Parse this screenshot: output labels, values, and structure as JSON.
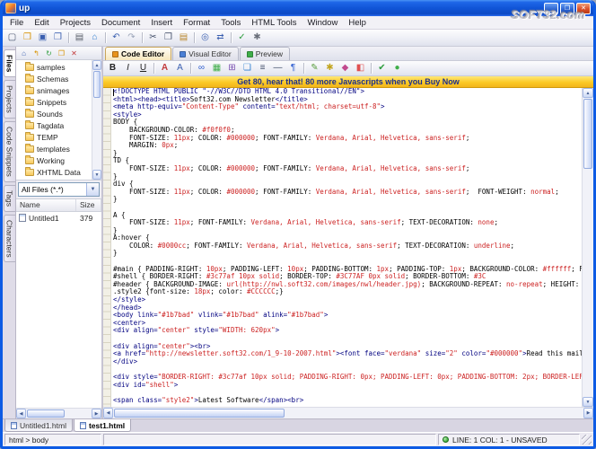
{
  "window": {
    "title": "up"
  },
  "watermark": "SOFT32.com",
  "icons": {
    "minimize": "_",
    "maximize": "❐",
    "close": "✕",
    "up": "▲",
    "down": "▼",
    "left": "◀",
    "right": "▶"
  },
  "menu": {
    "items": [
      "File",
      "Edit",
      "Projects",
      "Document",
      "Insert",
      "Format",
      "Tools",
      "HTML Tools",
      "Window",
      "Help"
    ]
  },
  "toolbar_main": {
    "icons": [
      {
        "n": "new-document",
        "g": "▢",
        "c": "#44506a"
      },
      {
        "n": "open-folder",
        "g": "❒",
        "c": "#d79200"
      },
      {
        "n": "save",
        "g": "▣",
        "c": "#3a5fb0"
      },
      {
        "n": "save-all",
        "g": "❐",
        "c": "#3a5fb0"
      },
      "|",
      {
        "n": "print",
        "g": "▤",
        "c": "#5a5f6a"
      },
      {
        "n": "preview-in-browser",
        "g": "⌂",
        "c": "#2f7fd0"
      },
      "|",
      {
        "n": "undo",
        "g": "↶",
        "c": "#3a5fb0"
      },
      {
        "n": "redo",
        "g": "↷",
        "c": "#9aa4b8"
      },
      "|",
      {
        "n": "cut",
        "g": "✂",
        "c": "#44506a"
      },
      {
        "n": "copy",
        "g": "❐",
        "c": "#44506a"
      },
      {
        "n": "paste",
        "g": "▤",
        "c": "#b8862a"
      },
      "|",
      {
        "n": "find",
        "g": "◎",
        "c": "#3a5fb0"
      },
      {
        "n": "find-replace",
        "g": "⇄",
        "c": "#3a5fb0"
      },
      "|",
      {
        "n": "spell-check",
        "g": "✓",
        "c": "#2f9e3f"
      },
      {
        "n": "settings",
        "g": "✱",
        "c": "#6a6f7a"
      }
    ]
  },
  "view_tabs": {
    "tabs": [
      {
        "label": "Code Editor",
        "active": true,
        "icon_color": "#e8931c"
      },
      {
        "label": "Visual Editor",
        "active": false,
        "icon_color": "#4a7fd6"
      },
      {
        "label": "Preview",
        "active": false,
        "icon_color": "#3fae49"
      }
    ]
  },
  "toolbar_html": {
    "icons": [
      {
        "n": "bold",
        "g": "B",
        "c": "#222222",
        "s": "b"
      },
      {
        "n": "italic",
        "g": "I",
        "c": "#222222",
        "s": "i"
      },
      {
        "n": "underline",
        "g": "U",
        "c": "#222222",
        "s": "u"
      },
      "|",
      {
        "n": "font-color",
        "g": "A",
        "c": "#c23a3a",
        "s": "b"
      },
      {
        "n": "font",
        "g": "A",
        "c": "#3a5fb0"
      },
      "|",
      {
        "n": "insert-link",
        "g": "∞",
        "c": "#2f5fd0"
      },
      {
        "n": "insert-image",
        "g": "▦",
        "c": "#3fae49"
      },
      {
        "n": "insert-table",
        "g": "⊞",
        "c": "#7a4fb0"
      },
      {
        "n": "insert-div",
        "g": "❏",
        "c": "#2f7fd0"
      },
      {
        "n": "insert-list",
        "g": "≡",
        "c": "#44506a"
      },
      {
        "n": "horizontal-rule",
        "g": "—",
        "c": "#44506a"
      },
      {
        "n": "line-break",
        "g": "¶",
        "c": "#2f5fd0"
      },
      "|",
      {
        "n": "insert-comment",
        "g": "✎",
        "c": "#5a9e3f"
      },
      {
        "n": "insert-script",
        "g": "✱",
        "c": "#c2a51e"
      },
      {
        "n": "insert-style",
        "g": "◆",
        "c": "#c24a8e"
      },
      {
        "n": "color-picker",
        "g": "◧",
        "c": "#e05050"
      },
      "|",
      {
        "n": "validate",
        "g": "✔",
        "c": "#2f9e3f"
      },
      {
        "n": "quick-preview",
        "g": "●",
        "c": "#3fae49"
      }
    ]
  },
  "banner": {
    "text": "Get 80, hear that! 80 more Javascripts when you Buy Now"
  },
  "side_tabs": {
    "items": [
      {
        "label": "Files",
        "active": true
      },
      {
        "label": "Projects",
        "active": false
      },
      {
        "label": "Code Snippets",
        "active": false
      },
      {
        "label": "Tags",
        "active": false
      },
      {
        "label": "Characters",
        "active": false
      }
    ]
  },
  "files_panel": {
    "toolbar": [
      {
        "n": "home-directory",
        "g": "⌂",
        "c": "#3a5fb0"
      },
      {
        "n": "up-one-level",
        "g": "↰",
        "c": "#d79200"
      },
      {
        "n": "refresh",
        "g": "↻",
        "c": "#2f9e3f"
      },
      {
        "n": "new-folder",
        "g": "❒",
        "c": "#d79200"
      },
      {
        "n": "delete",
        "g": "✕",
        "c": "#c23a3a"
      }
    ],
    "tree": [
      "samples",
      "Schemas",
      "snimages",
      "Snippets",
      "Sounds",
      "Tagdata",
      "TEMP",
      "templates",
      "Working",
      "XHTML Data"
    ],
    "filter": "All Files (*.*)",
    "list": {
      "columns": [
        "Name",
        "Size"
      ],
      "rows": [
        {
          "name": "Untitled1",
          "size": "379"
        }
      ]
    }
  },
  "editor": {
    "colors": {
      "tag": "#000080",
      "value": "#cc2222",
      "plain": "#000000"
    },
    "lines": [
      [
        [
          "t",
          "<!DOCTYPE HTML PUBLIC \"-//W3C//DTD HTML 4.0 Transitional//EN\">"
        ]
      ],
      [
        [
          "t",
          "<html><head><title>"
        ],
        [
          "p",
          "Soft32.com Newsletter"
        ],
        [
          "t",
          "</title>"
        ]
      ],
      [
        [
          "t",
          "<meta http-equiv="
        ],
        [
          "v",
          "\"Content-Type\""
        ],
        [
          "t",
          " content="
        ],
        [
          "v",
          "\"text/html; charset=utf-8\""
        ],
        [
          "t",
          ">"
        ]
      ],
      [
        [
          "t",
          "<style>"
        ]
      ],
      [
        [
          "p",
          "BODY {"
        ]
      ],
      [
        [
          "p",
          "    BACKGROUND-COLOR: "
        ],
        [
          "v",
          "#f0f0f0"
        ],
        [
          "p",
          ";"
        ]
      ],
      [
        [
          "p",
          "    FONT-SIZE: "
        ],
        [
          "v",
          "11px"
        ],
        [
          "p",
          "; COLOR: "
        ],
        [
          "v",
          "#000000"
        ],
        [
          "p",
          "; FONT-FAMILY: "
        ],
        [
          "v",
          "Verdana, Arial, Helvetica, sans-serif"
        ],
        [
          "p",
          ";"
        ]
      ],
      [
        [
          "p",
          "    MARGIN: "
        ],
        [
          "v",
          "0px"
        ],
        [
          "p",
          ";"
        ]
      ],
      [
        [
          "p",
          "}"
        ]
      ],
      [
        [
          "p",
          "TD {"
        ]
      ],
      [
        [
          "p",
          "    FONT-SIZE: "
        ],
        [
          "v",
          "11px"
        ],
        [
          "p",
          "; COLOR: "
        ],
        [
          "v",
          "#000000"
        ],
        [
          "p",
          "; FONT-FAMILY: "
        ],
        [
          "v",
          "Verdana, Arial, Helvetica, sans-serif"
        ],
        [
          "p",
          ";"
        ]
      ],
      [
        [
          "p",
          "}"
        ]
      ],
      [
        [
          "p",
          "div {"
        ]
      ],
      [
        [
          "p",
          "    FONT-SIZE: "
        ],
        [
          "v",
          "11px"
        ],
        [
          "p",
          "; COLOR: "
        ],
        [
          "v",
          "#000000"
        ],
        [
          "p",
          "; FONT-FAMILY: "
        ],
        [
          "v",
          "Verdana, Arial, Helvetica, sans-serif"
        ],
        [
          "p",
          ";  FONT-WEIGHT: "
        ],
        [
          "v",
          "normal"
        ],
        [
          "p",
          ";"
        ]
      ],
      [
        [
          "p",
          "}"
        ]
      ],
      [],
      [
        [
          "p",
          "A {"
        ]
      ],
      [
        [
          "p",
          "    FONT-SIZE: "
        ],
        [
          "v",
          "11px"
        ],
        [
          "p",
          "; FONT-FAMILY: "
        ],
        [
          "v",
          "Verdana, Arial, Helvetica, sans-serif"
        ],
        [
          "p",
          "; TEXT-DECORATION: "
        ],
        [
          "v",
          "none"
        ],
        [
          "p",
          ";"
        ]
      ],
      [
        [
          "p",
          "}"
        ]
      ],
      [
        [
          "p",
          "A:hover {"
        ]
      ],
      [
        [
          "p",
          "    COLOR: "
        ],
        [
          "v",
          "#0000cc"
        ],
        [
          "p",
          "; FONT-FAMILY: "
        ],
        [
          "v",
          "Verdana, Arial, Helvetica, sans-serif"
        ],
        [
          "p",
          "; TEXT-DECORATION: "
        ],
        [
          "v",
          "underline"
        ],
        [
          "p",
          ";"
        ]
      ],
      [
        [
          "p",
          "}"
        ]
      ],
      [],
      [
        [
          "p",
          "#main { PADDING-RIGHT: "
        ],
        [
          "v",
          "10px"
        ],
        [
          "p",
          "; PADDING-LEFT: "
        ],
        [
          "v",
          "10px"
        ],
        [
          "p",
          "; PADDING-BOTTOM: "
        ],
        [
          "v",
          "1px"
        ],
        [
          "p",
          "; PADDING-TOP: "
        ],
        [
          "v",
          "1px"
        ],
        [
          "p",
          "; BACKGROUND-COLOR: "
        ],
        [
          "v",
          "#ffffff"
        ],
        [
          "p",
          "; FONT-FAMIL"
        ]
      ],
      [
        [
          "p",
          "#shell { BORDER-RIGHT: "
        ],
        [
          "v",
          "#3c77af 10px solid"
        ],
        [
          "p",
          "; BORDER-TOP: "
        ],
        [
          "v",
          "#3C77AF 0px solid"
        ],
        [
          "p",
          "; BORDER-BOTTOM: "
        ],
        [
          "v",
          "#3C"
        ]
      ],
      [
        [
          "p",
          "#header { BACKGROUND-IMAGE: "
        ],
        [
          "v",
          "url(http://nwl.soft32.com/images/nwl/header.jpg)"
        ],
        [
          "p",
          "; BACKGROUND-REPEAT: "
        ],
        [
          "v",
          "no-repeat"
        ],
        [
          "p",
          "; HEIGHT: "
        ],
        [
          "v",
          "54px"
        ],
        [
          "p",
          "; BAC"
        ]
      ],
      [
        [
          "p",
          ".style2 {font-size: "
        ],
        [
          "v",
          "18px"
        ],
        [
          "p",
          "; color: "
        ],
        [
          "v",
          "#CCCCCC"
        ],
        [
          "p",
          ";}"
        ]
      ],
      [
        [
          "t",
          "</style>"
        ]
      ],
      [
        [
          "t",
          "</head>"
        ]
      ],
      [
        [
          "t",
          "<body link="
        ],
        [
          "v",
          "\"#1b7bad\""
        ],
        [
          "t",
          " vlink="
        ],
        [
          "v",
          "\"#1b7bad\""
        ],
        [
          "t",
          " alink="
        ],
        [
          "v",
          "\"#1b7bad\""
        ],
        [
          "t",
          ">"
        ]
      ],
      [
        [
          "t",
          "<center>"
        ]
      ],
      [
        [
          "t",
          "<div align="
        ],
        [
          "v",
          "\"center\""
        ],
        [
          "t",
          " style="
        ],
        [
          "v",
          "\"WIDTH: 620px\""
        ],
        [
          "t",
          ">"
        ]
      ],
      [],
      [
        [
          "t",
          "<div align="
        ],
        [
          "v",
          "\"center\""
        ],
        [
          "t",
          "><br>"
        ]
      ],
      [
        [
          "t",
          "<a href="
        ],
        [
          "v",
          "\"http://newsletter.soft32.com/1_9-10-2007.html\""
        ],
        [
          "t",
          "><font face="
        ],
        [
          "v",
          "\"verdana\""
        ],
        [
          "t",
          " size="
        ],
        [
          "v",
          "\"2\""
        ],
        [
          "t",
          " color="
        ],
        [
          "v",
          "\"#000000\""
        ],
        [
          "t",
          ">"
        ],
        [
          "p",
          "Read this mail online"
        ],
        [
          "t",
          "</"
        ]
      ],
      [
        [
          "t",
          "</div>"
        ]
      ],
      [],
      [
        [
          "t",
          "<div style="
        ],
        [
          "v",
          "\"BORDER-RIGHT: #3c77af 10px solid; PADDING-RIGHT: 0px; PADDING-LEFT: 0px; PADDING-BOTTOM: 2px; BORDER-LEFT: #3c77a"
        ]
      ],
      [
        [
          "t",
          "<div id="
        ],
        [
          "v",
          "\"shell\""
        ],
        [
          "t",
          ">"
        ]
      ],
      [],
      [
        [
          "t",
          "<span class="
        ],
        [
          "v",
          "\"style2\""
        ],
        [
          "t",
          ">"
        ],
        [
          "p",
          "Latest Software"
        ],
        [
          "t",
          "</span><br>"
        ]
      ]
    ]
  },
  "bottom_tabs": {
    "tabs": [
      {
        "label": "Untitled1.html",
        "active": false
      },
      {
        "label": "test1.html",
        "active": true
      }
    ]
  },
  "status": {
    "path": "html > body",
    "position": "LINE: 1 COL: 1 - UNSAVED"
  }
}
